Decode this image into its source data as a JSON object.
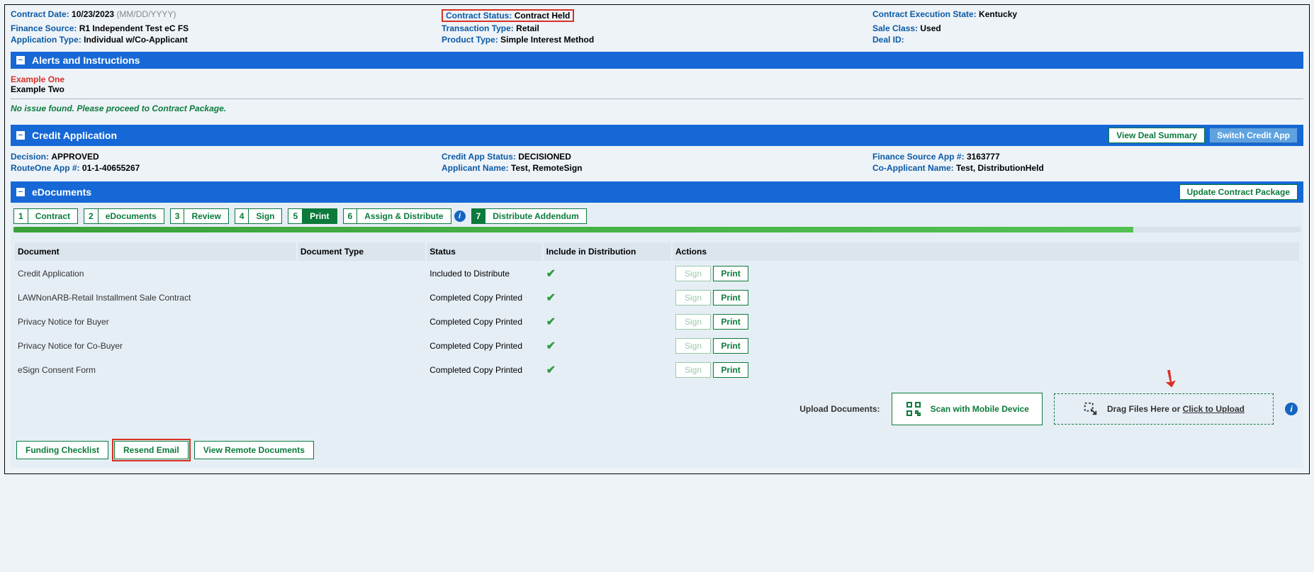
{
  "header": {
    "contract_date_label": "Contract Date:",
    "contract_date": "10/23/2023",
    "date_format": "(MM/DD/YYYY)",
    "contract_status_label": "Contract Status:",
    "contract_status": "Contract Held",
    "exec_state_label": "Contract Execution State:",
    "exec_state": "Kentucky",
    "finance_source_label": "Finance Source:",
    "finance_source": "R1 Independent Test eC FS",
    "txn_type_label": "Transaction Type:",
    "txn_type": "Retail",
    "sale_class_label": "Sale Class:",
    "sale_class": "Used",
    "app_type_label": "Application Type:",
    "app_type": "Individual w/Co-Applicant",
    "product_type_label": "Product Type:",
    "product_type": "Simple Interest Method",
    "deal_id_label": "Deal ID:",
    "deal_id": ""
  },
  "sections": {
    "alerts_title": "Alerts and Instructions",
    "credit_title": "Credit Application",
    "edoc_title": "eDocuments"
  },
  "alerts": {
    "example_one": "Example One",
    "example_two": "Example Two",
    "no_issue": "No issue found. Please proceed to Contract Package."
  },
  "credit_buttons": {
    "view_deal": "View Deal Summary",
    "switch_app": "Switch Credit App"
  },
  "credit": {
    "decision_label": "Decision:",
    "decision": "APPROVED",
    "status_label": "Credit App Status:",
    "status": "DECISIONED",
    "fs_app_label": "Finance Source App #:",
    "fs_app": "3163777",
    "r1_app_label": "RouteOne App #:",
    "r1_app": "01-1-40655267",
    "applicant_label": "Applicant Name:",
    "applicant": "Test, RemoteSign",
    "coapplicant_label": "Co-Applicant Name:",
    "coapplicant": "Test, DistributionHeld"
  },
  "edoc_buttons": {
    "update_pkg": "Update Contract Package"
  },
  "wizard": [
    {
      "num": "1",
      "label": "Contract"
    },
    {
      "num": "2",
      "label": "eDocuments"
    },
    {
      "num": "3",
      "label": "Review"
    },
    {
      "num": "4",
      "label": "Sign"
    },
    {
      "num": "5",
      "label": "Print"
    },
    {
      "num": "6",
      "label": "Assign & Distribute"
    },
    {
      "num": "7",
      "label": "Distribute Addendum"
    }
  ],
  "table": {
    "headers": {
      "document": "Document",
      "doc_type": "Document Type",
      "status": "Status",
      "include": "Include in Distribution",
      "actions": "Actions"
    },
    "rows": [
      {
        "name": "Credit Application",
        "type": "",
        "status": "Included to Distribute"
      },
      {
        "name": "LAWNonARB-Retail Installment Sale Contract",
        "type": "",
        "status": "Completed Copy Printed"
      },
      {
        "name": "Privacy Notice for Buyer",
        "type": "",
        "status": "Completed Copy Printed"
      },
      {
        "name": "Privacy Notice for Co-Buyer",
        "type": "",
        "status": "Completed Copy Printed"
      },
      {
        "name": "eSign Consent Form",
        "type": "",
        "status": "Completed Copy Printed"
      }
    ],
    "sign_btn": "Sign",
    "print_btn": "Print"
  },
  "upload": {
    "label": "Upload Documents:",
    "scan": "Scan with Mobile Device",
    "drag": "Drag Files Here or ",
    "click": "Click to Upload"
  },
  "bottom": {
    "funding": "Funding Checklist",
    "resend": "Resend Email",
    "view_remote": "View Remote Documents"
  }
}
